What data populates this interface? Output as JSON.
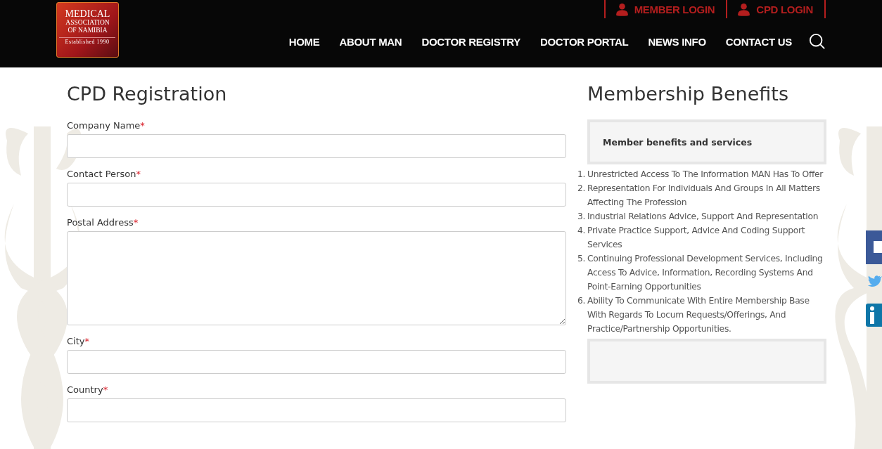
{
  "header": {
    "logo": {
      "lines": [
        "MEDICAL",
        "ASSOCIATION",
        "OF NAMIBIA"
      ],
      "tagline": "Established 1990"
    },
    "top_links": [
      {
        "label": "MEMBER LOGIN"
      },
      {
        "label": "CPD LOGIN"
      }
    ],
    "nav": [
      {
        "label": "HOME"
      },
      {
        "label": "ABOUT MAN"
      },
      {
        "label": "DOCTOR REGISTRY"
      },
      {
        "label": "DOCTOR PORTAL"
      },
      {
        "label": "NEWS INFO"
      },
      {
        "label": "CONTACT US"
      }
    ]
  },
  "form": {
    "title": "CPD Registration",
    "fields": [
      {
        "label": "Company Name",
        "mark": "*",
        "kind": "input"
      },
      {
        "label": "Contact Person",
        "mark": "*",
        "kind": "input"
      },
      {
        "label": "Postal Address",
        "mark": "*",
        "kind": "textarea"
      },
      {
        "label": "City",
        "mark": "*",
        "kind": "input"
      },
      {
        "label": "Country",
        "mark": "*",
        "kind": "input"
      }
    ]
  },
  "benefits": {
    "title": "Membership Benefits",
    "box_title": "Member benefits and services",
    "items": [
      {
        "number": "1.",
        "text": "Unrestricted Access To The Information MAN Has To Offer"
      },
      {
        "number": "2.",
        "text": "Representation For Individuals And Groups In All Matters Affecting The Profession"
      },
      {
        "number": "3.",
        "text": "Industrial Relations Advice, Support And Representation"
      },
      {
        "number": "4.",
        "text": "Private Practice Support, Advice And Coding Support Services"
      },
      {
        "number": "5.",
        "text": "Continuing Professional Development Services, Including Access To Advice, Information, Recording Systems And Point-Earning Opportunities"
      },
      {
        "number": "6.",
        "text": "Ability To Communicate With Entire Membership Base With Regards To Locum Requests/Offerings, And Practice/Partnership Opportunities."
      }
    ]
  }
}
